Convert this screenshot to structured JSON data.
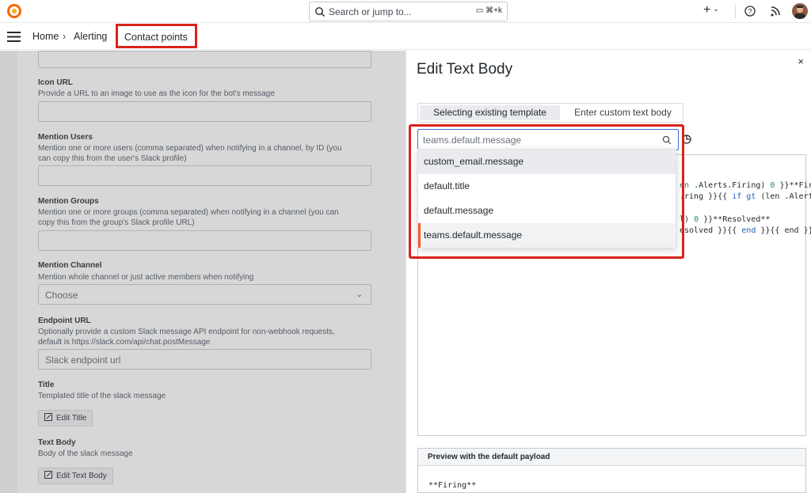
{
  "topbar": {
    "search_placeholder": "Search or jump to...",
    "shortcut": "⌘+k",
    "plus_label": "+"
  },
  "breadcrumb": {
    "home": "Home",
    "separator": "›",
    "alerting": "Alerting",
    "contact_points": "Contact points"
  },
  "form": {
    "icon_url": {
      "label": "Icon URL",
      "desc": "Provide a URL to an image to use as the icon for the bot's message"
    },
    "mention_users": {
      "label": "Mention Users",
      "desc": "Mention one or more users (comma separated) when notifying in a channel, by ID (you can copy this from the user's Slack profile)"
    },
    "mention_groups": {
      "label": "Mention Groups",
      "desc": "Mention one or more groups (comma separated) when notifying in a channel (you can copy this from the group's Slack profile URL)"
    },
    "mention_channel": {
      "label": "Mention Channel",
      "desc": "Mention whole channel or just active members when notifying",
      "value": "Choose"
    },
    "endpoint_url": {
      "label": "Endpoint URL",
      "desc": "Optionally provide a custom Slack message API endpoint for non-webhook requests, default is https://slack.com/api/chat.postMessage",
      "placeholder": "Slack endpoint url"
    },
    "title": {
      "label": "Title",
      "desc": "Templated title of the slack message",
      "button": "Edit Title"
    },
    "text_body": {
      "label": "Text Body",
      "desc": "Body of the slack message",
      "button": "Edit Text Body"
    }
  },
  "drawer": {
    "title": "Edit Text Body",
    "close": "×",
    "tabs": [
      "Selecting existing template",
      "Enter custom text body"
    ],
    "search_value": "teams.default.message",
    "options": [
      "custom_email.message",
      "default.title",
      "default.message",
      "teams.default.message"
    ],
    "code_lines": [
      {
        "pre": "",
        "kw": "en",
        "rest": " .Alerts.Firing) ",
        "num": "0",
        "tail": " }}**Fir"
      },
      {
        "pre": "",
        "kw": "",
        "rest": ".ring }}{{ ",
        "num": "if gt",
        "tail": " (len .Alert"
      },
      {
        "pre": "",
        "kw": "",
        "rest": "",
        "num": "",
        "tail": ""
      },
      {
        "pre": "",
        "kw": "",
        "rest": "l) ",
        "num": "0",
        "tail": " }}**Resolved**"
      },
      {
        "pre": "",
        "kw": "",
        "rest": "esolved }}{{ ",
        "num": "end",
        "tail": " }}{{ end }}"
      }
    ],
    "preview_header": "Preview with the default payload",
    "preview_body": "**Firing**"
  }
}
